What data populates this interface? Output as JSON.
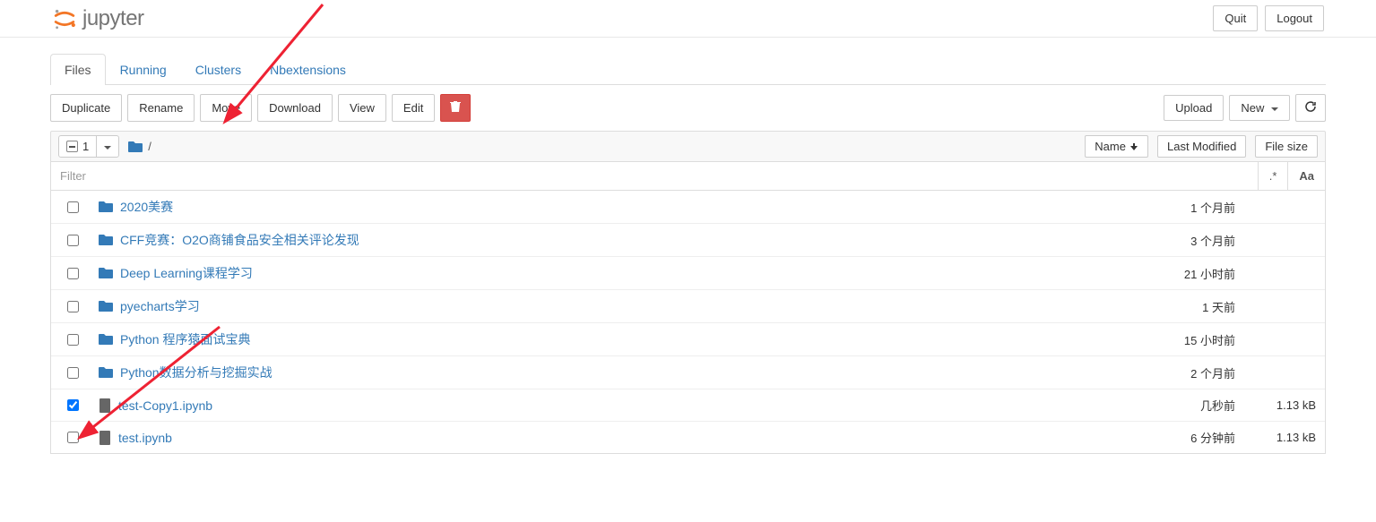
{
  "header": {
    "logo_text": "jupyter",
    "quit": "Quit",
    "logout": "Logout"
  },
  "tabs": [
    {
      "label": "Files",
      "active": true
    },
    {
      "label": "Running",
      "active": false
    },
    {
      "label": "Clusters",
      "active": false
    },
    {
      "label": "Nbextensions",
      "active": false
    }
  ],
  "actions": {
    "duplicate": "Duplicate",
    "rename": "Rename",
    "move": "Move",
    "download": "Download",
    "view": "View",
    "edit": "Edit"
  },
  "right_actions": {
    "upload": "Upload",
    "new": "New"
  },
  "select": {
    "count": "1",
    "breadcrumb": "/"
  },
  "sort": {
    "name": "Name",
    "modified": "Last Modified",
    "size": "File size"
  },
  "filter": {
    "placeholder": "Filter",
    "regex": ".*",
    "case": "Aa"
  },
  "files": [
    {
      "type": "folder",
      "name": "2020美赛",
      "modified": "1 个月前",
      "size": "",
      "checked": false
    },
    {
      "type": "folder",
      "name": "CFF竞赛：O2O商铺食品安全相关评论发现",
      "modified": "3 个月前",
      "size": "",
      "checked": false
    },
    {
      "type": "folder",
      "name": "Deep Learning课程学习",
      "modified": "21 小时前",
      "size": "",
      "checked": false
    },
    {
      "type": "folder",
      "name": "pyecharts学习",
      "modified": "1 天前",
      "size": "",
      "checked": false
    },
    {
      "type": "folder",
      "name": "Python 程序猿面试宝典",
      "modified": "15 小时前",
      "size": "",
      "checked": false
    },
    {
      "type": "folder",
      "name": "Python数据分析与挖掘实战",
      "modified": "2 个月前",
      "size": "",
      "checked": false
    },
    {
      "type": "notebook",
      "name": "test-Copy1.ipynb",
      "modified": "几秒前",
      "size": "1.13 kB",
      "checked": true
    },
    {
      "type": "notebook",
      "name": "test.ipynb",
      "modified": "6 分钟前",
      "size": "1.13 kB",
      "checked": false
    }
  ]
}
